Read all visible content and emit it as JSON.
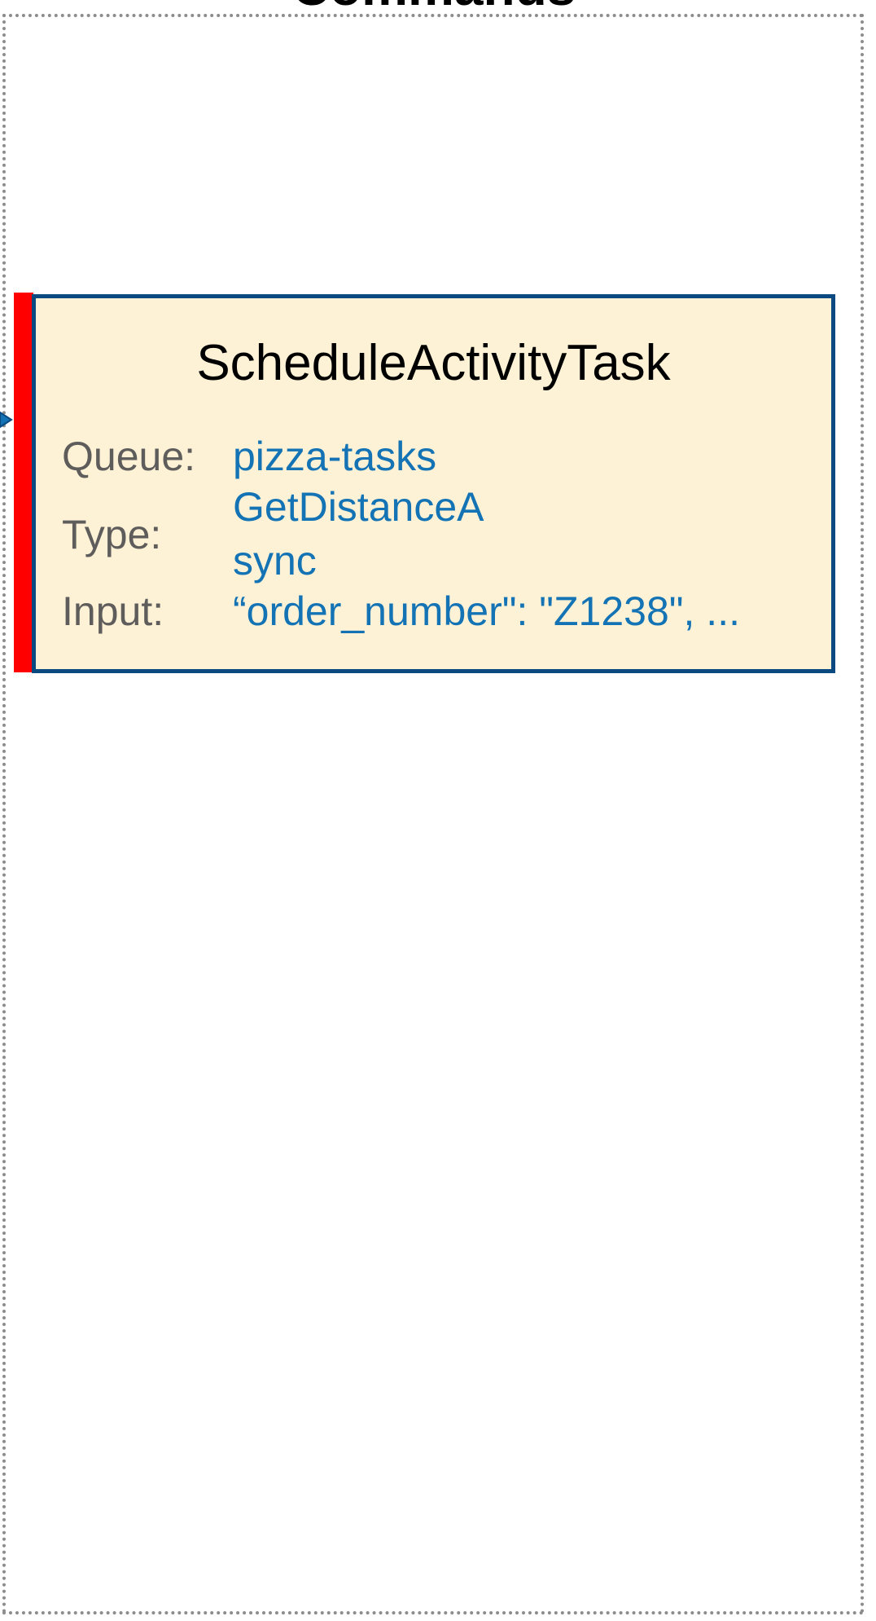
{
  "diagram": {
    "section_title": "Commands",
    "colors": {
      "frame_border": "#8c8c8c",
      "card_border": "#0b4a80",
      "card_fill": "#fdf2d6",
      "state_bar": "#ff0000",
      "label_text": "#5f5c5c",
      "value_text": "#1373b4"
    },
    "command_card": {
      "title": "ScheduleActivityTask",
      "queue_label": "Queue:",
      "queue_value": "pizza-tasks",
      "type_label": "Type:",
      "type_value_line1": "GetDistanceA",
      "type_value_line2": "sync",
      "input_label": "Input:",
      "input_value": "“order_number\": \"Z1238\", ..."
    }
  }
}
